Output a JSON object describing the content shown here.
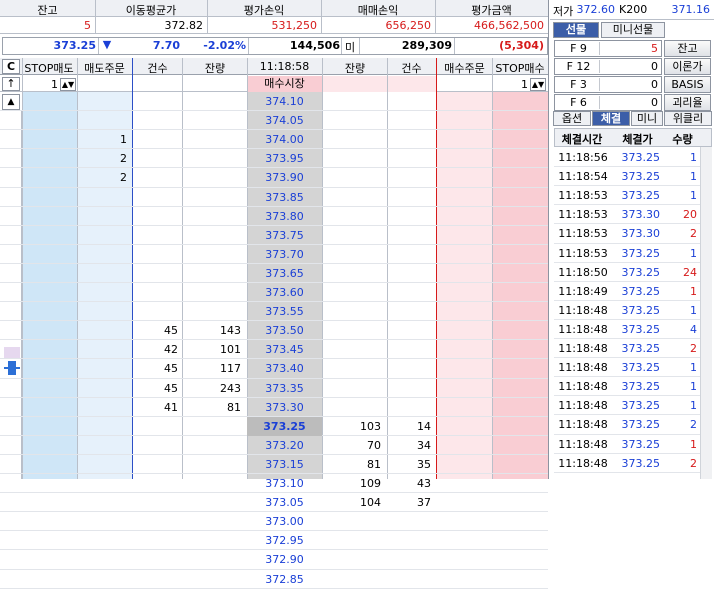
{
  "summary": {
    "headers": [
      "잔고",
      "이동평균가",
      "평가손익",
      "매매손익",
      "평가금액"
    ],
    "values": [
      "5",
      "372.82",
      "531,250",
      "656,250",
      "466,562,500"
    ]
  },
  "ticker": {
    "price": "373.25",
    "change": "7.70",
    "change_pct": "-2.02%",
    "volume": "144,506",
    "mi_label": "미",
    "open_interest": "289,309",
    "oi_change": "(5,304)"
  },
  "right_top": {
    "low_label": "저가",
    "low_value": "372.60",
    "k200_label": "K200",
    "k200_value": "371.16"
  },
  "right_tabs": [
    "선물",
    "미니선물"
  ],
  "fkeys": [
    {
      "key": "F 9",
      "value": "5",
      "button": "잔고"
    },
    {
      "key": "F 12",
      "value": "0",
      "button": "이론가"
    },
    {
      "key": "F 3",
      "value": "0",
      "button": "BASIS"
    },
    {
      "key": "F 6",
      "value": "0",
      "button": "괴리율"
    }
  ],
  "trade_tabs": [
    "옵션",
    "체결",
    "미니",
    "위클리"
  ],
  "trades": {
    "headers": [
      "체결시간",
      "체결가",
      "수량"
    ],
    "rows": [
      {
        "time": "11:18:56",
        "price": "373.25",
        "qty": "1",
        "color": "blue"
      },
      {
        "time": "11:18:54",
        "price": "373.25",
        "qty": "1",
        "color": "blue"
      },
      {
        "time": "11:18:53",
        "price": "373.25",
        "qty": "1",
        "color": "blue"
      },
      {
        "time": "11:18:53",
        "price": "373.30",
        "qty": "20",
        "color": "red"
      },
      {
        "time": "11:18:53",
        "price": "373.30",
        "qty": "2",
        "color": "red"
      },
      {
        "time": "11:18:53",
        "price": "373.25",
        "qty": "1",
        "color": "blue"
      },
      {
        "time": "11:18:50",
        "price": "373.25",
        "qty": "24",
        "color": "red"
      },
      {
        "time": "11:18:49",
        "price": "373.25",
        "qty": "1",
        "color": "red"
      },
      {
        "time": "11:18:48",
        "price": "373.25",
        "qty": "1",
        "color": "blue"
      },
      {
        "time": "11:18:48",
        "price": "373.25",
        "qty": "4",
        "color": "blue"
      },
      {
        "time": "11:18:48",
        "price": "373.25",
        "qty": "2",
        "color": "red"
      },
      {
        "time": "11:18:48",
        "price": "373.25",
        "qty": "1",
        "color": "blue"
      },
      {
        "time": "11:18:48",
        "price": "373.25",
        "qty": "1",
        "color": "blue"
      },
      {
        "time": "11:18:48",
        "price": "373.25",
        "qty": "1",
        "color": "blue"
      },
      {
        "time": "11:18:48",
        "price": "373.25",
        "qty": "2",
        "color": "blue"
      },
      {
        "time": "11:18:48",
        "price": "373.25",
        "qty": "1",
        "color": "red"
      },
      {
        "time": "11:18:48",
        "price": "373.25",
        "qty": "2",
        "color": "red"
      }
    ]
  },
  "book": {
    "headers": [
      "C",
      "STOP매도",
      "매도주문",
      "건수",
      "잔량",
      "11:18:58",
      "잔량",
      "건수",
      "매수주문",
      "STOP매수"
    ],
    "stop_sell_qty": "1",
    "market_label": "매수시장",
    "stop_buy_qty": "1",
    "rows": [
      {
        "sell_order": "",
        "cnt": "",
        "rem": "",
        "price": "374.10",
        "brem": "",
        "bcnt": ""
      },
      {
        "sell_order": "",
        "cnt": "",
        "rem": "",
        "price": "374.05",
        "brem": "",
        "bcnt": ""
      },
      {
        "sell_order": "1",
        "cnt": "",
        "rem": "",
        "price": "374.00",
        "brem": "",
        "bcnt": ""
      },
      {
        "sell_order": "2",
        "cnt": "",
        "rem": "",
        "price": "373.95",
        "brem": "",
        "bcnt": ""
      },
      {
        "sell_order": "2",
        "cnt": "",
        "rem": "",
        "price": "373.90",
        "brem": "",
        "bcnt": ""
      },
      {
        "sell_order": "",
        "cnt": "",
        "rem": "",
        "price": "373.85",
        "brem": "",
        "bcnt": ""
      },
      {
        "sell_order": "",
        "cnt": "",
        "rem": "",
        "price": "373.80",
        "brem": "",
        "bcnt": ""
      },
      {
        "sell_order": "",
        "cnt": "",
        "rem": "",
        "price": "373.75",
        "brem": "",
        "bcnt": ""
      },
      {
        "sell_order": "",
        "cnt": "",
        "rem": "",
        "price": "373.70",
        "brem": "",
        "bcnt": ""
      },
      {
        "sell_order": "",
        "cnt": "",
        "rem": "",
        "price": "373.65",
        "brem": "",
        "bcnt": ""
      },
      {
        "sell_order": "",
        "cnt": "",
        "rem": "",
        "price": "373.60",
        "brem": "",
        "bcnt": ""
      },
      {
        "sell_order": "",
        "cnt": "",
        "rem": "",
        "price": "373.55",
        "brem": "",
        "bcnt": ""
      },
      {
        "sell_order": "",
        "cnt": "45",
        "rem": "143",
        "price": "373.50",
        "brem": "",
        "bcnt": ""
      },
      {
        "sell_order": "",
        "cnt": "42",
        "rem": "101",
        "price": "373.45",
        "brem": "",
        "bcnt": ""
      },
      {
        "sell_order": "",
        "cnt": "45",
        "rem": "117",
        "price": "373.40",
        "brem": "",
        "bcnt": ""
      },
      {
        "sell_order": "",
        "cnt": "45",
        "rem": "243",
        "price": "373.35",
        "brem": "",
        "bcnt": ""
      },
      {
        "sell_order": "",
        "cnt": "41",
        "rem": "81",
        "price": "373.30",
        "brem": "",
        "bcnt": ""
      },
      {
        "sell_order": "",
        "cnt": "",
        "rem": "",
        "price": "373.25",
        "brem": "103",
        "bcnt": "14"
      },
      {
        "sell_order": "",
        "cnt": "",
        "rem": "",
        "price": "373.20",
        "brem": "70",
        "bcnt": "34"
      },
      {
        "sell_order": "",
        "cnt": "",
        "rem": "",
        "price": "373.15",
        "brem": "81",
        "bcnt": "35"
      },
      {
        "sell_order": "",
        "cnt": "",
        "rem": "",
        "price": "373.10",
        "brem": "109",
        "bcnt": "43"
      },
      {
        "sell_order": "",
        "cnt": "",
        "rem": "",
        "price": "373.05",
        "brem": "104",
        "bcnt": "37"
      },
      {
        "sell_order": "",
        "cnt": "",
        "rem": "",
        "price": "373.00",
        "brem": "",
        "bcnt": ""
      },
      {
        "sell_order": "",
        "cnt": "",
        "rem": "",
        "price": "372.95",
        "brem": "",
        "bcnt": ""
      },
      {
        "sell_order": "",
        "cnt": "",
        "rem": "",
        "price": "372.90",
        "brem": "",
        "bcnt": ""
      },
      {
        "sell_order": "",
        "cnt": "",
        "rem": "",
        "price": "372.85",
        "brem": "",
        "bcnt": ""
      }
    ]
  },
  "colors": {
    "sell_stop": "#cfe6f7",
    "sell_order": "#e6f1fb",
    "price_col": "#d4d4d4",
    "price_current": "#bcbcbc",
    "buy_order": "#fde7ea",
    "buy_stop": "#f9cdd3",
    "buy_market": "#f9cdd3"
  }
}
